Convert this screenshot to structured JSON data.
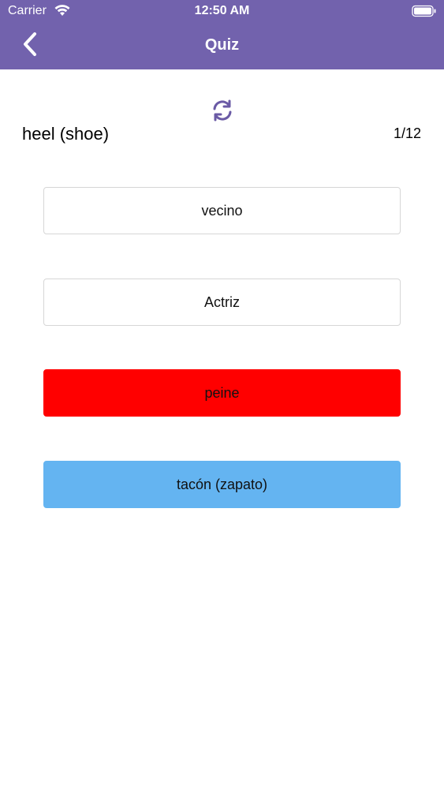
{
  "status_bar": {
    "carrier": "Carrier",
    "time": "12:50 AM",
    "icons": [
      "wifi-icon",
      "battery-icon"
    ]
  },
  "nav": {
    "title": "Quiz",
    "back_icon": "chevron-left-icon"
  },
  "quiz": {
    "refresh_icon": "refresh-icon",
    "question": "heel (shoe)",
    "progress": "1/12",
    "options": [
      {
        "label": "vecino",
        "state": "default"
      },
      {
        "label": "Actriz",
        "state": "default"
      },
      {
        "label": "peine",
        "state": "wrong"
      },
      {
        "label": "tacón (zapato)",
        "state": "correct"
      }
    ]
  },
  "colors": {
    "header": "#7262ad",
    "wrong": "#ff0000",
    "correct": "#64b4f1"
  }
}
